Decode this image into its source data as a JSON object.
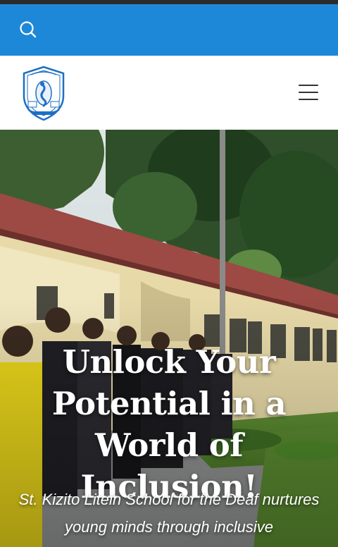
{
  "colors": {
    "search_bar_bg": "#1e88d8",
    "top_strip": "#2b2b2b",
    "header_bg": "#ffffff",
    "logo_blue": "#1e6fc2"
  },
  "icons": {
    "search": "search-icon",
    "menu": "hamburger-menu-icon",
    "logo": "school-crest-logo"
  },
  "hero": {
    "title": "Unlock Your Potential in a World of Inclusion!",
    "subtitle": "St. Kizito Litein School for the Deaf nurtures young minds through inclusive"
  }
}
